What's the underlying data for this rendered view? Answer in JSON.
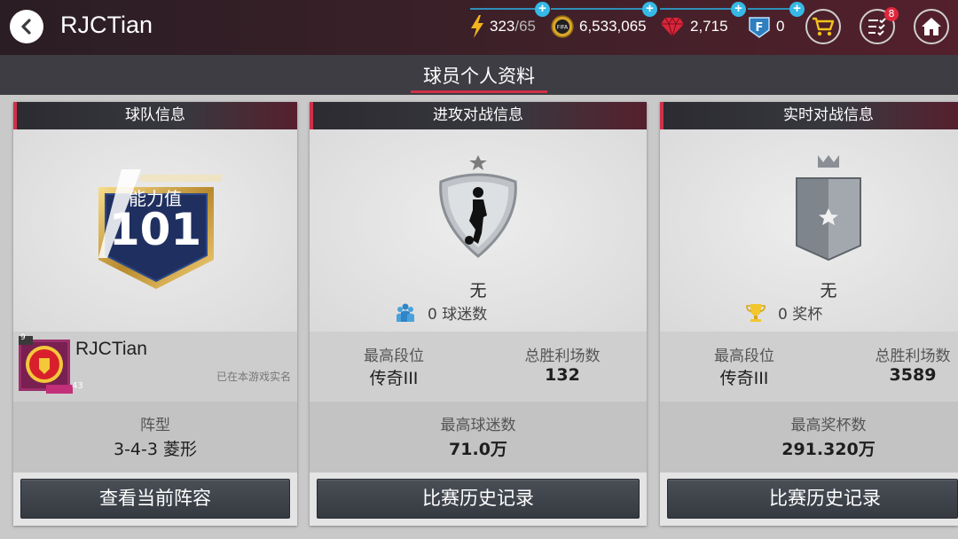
{
  "header": {
    "player_name": "RJCTian",
    "energy": "323",
    "energy_max": "/65",
    "coins": "6,533,065",
    "gems": "2,715",
    "fifa_points": "0",
    "tasks_badge": "8",
    "coin_logo_text": "FIFA"
  },
  "page_title": "球员个人资料",
  "team_panel": {
    "title": "球队信息",
    "rating_label": "能力值",
    "rating_value": "101",
    "team_name": "RJCTian",
    "level": "9",
    "club_level": "43",
    "verified_text": "已在本游戏实名",
    "formation_label": "阵型",
    "formation_value": "3-4-3 菱形",
    "button_label": "查看当前阵容"
  },
  "attack_panel": {
    "title": "进攻对战信息",
    "rank_name": "无",
    "fans_stat": "0 球迷数",
    "best_rank_label": "最高段位",
    "best_rank_value": "传奇III",
    "total_wins_label": "总胜利场数",
    "total_wins_value": "132",
    "max_fans_label": "最高球迷数",
    "max_fans_value": "71.0万",
    "button_label": "比赛历史记录"
  },
  "live_panel": {
    "title": "实时对战信息",
    "rank_name": "无",
    "trophy_stat": "0 奖杯",
    "best_rank_label": "最高段位",
    "best_rank_value": "传奇III",
    "total_wins_label": "总胜利场数",
    "total_wins_value": "3589",
    "max_trophies_label": "最高奖杯数",
    "max_trophies_value": "291.320万",
    "button_label": "比赛历史记录"
  },
  "colors": {
    "accent_red": "#d0304a",
    "accent_blue": "#36b9e6",
    "panel_bg": "#e4e4e4"
  },
  "icons": [
    "back-icon",
    "energy-icon",
    "coin-icon",
    "gem-icon",
    "fifa-points-icon",
    "cart-icon",
    "tasks-icon",
    "home-icon",
    "silver-shield-icon",
    "crown-shield-icon",
    "fans-icon",
    "trophy-icon",
    "club-crest-icon"
  ]
}
